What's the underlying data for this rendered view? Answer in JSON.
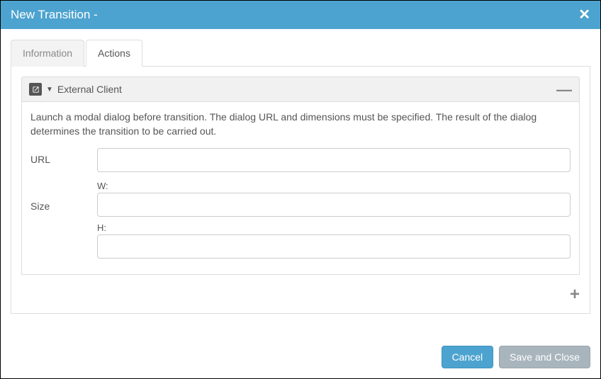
{
  "header": {
    "title": "New Transition -"
  },
  "tabs": {
    "information": "Information",
    "actions": "Actions"
  },
  "panel": {
    "title": "External Client",
    "description": "Launch a modal dialog before transition. The dialog URL and dimensions must be specified. The result of the dialog determines the transition to be carried out."
  },
  "form": {
    "url_label": "URL",
    "url_value": "",
    "size_label": "Size",
    "w_label": "W:",
    "w_value": "",
    "h_label": "H:",
    "h_value": ""
  },
  "buttons": {
    "cancel": "Cancel",
    "save": "Save and Close"
  }
}
